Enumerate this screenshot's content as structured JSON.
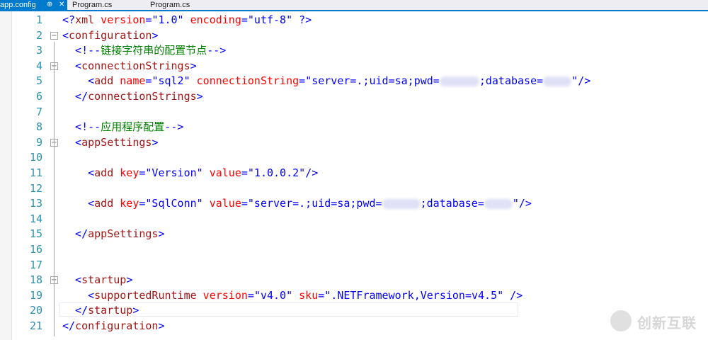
{
  "tabs": [
    {
      "label": "app.config",
      "pin": "⊕",
      "close": "✕",
      "active": true
    },
    {
      "label": "Program.cs",
      "active": false
    },
    {
      "label": "Program.cs",
      "active": false
    }
  ],
  "lines": [
    {
      "n": "1",
      "fold": "",
      "segs": [
        [
          "punct",
          "<?"
        ],
        [
          "ename",
          "xml"
        ],
        [
          "attr",
          " version"
        ],
        [
          "punct",
          "="
        ],
        [
          "val",
          "\"1.0\""
        ],
        [
          "attr",
          " encoding"
        ],
        [
          "punct",
          "="
        ],
        [
          "val",
          "\"utf-8\""
        ],
        [
          "punct",
          " ?>"
        ]
      ]
    },
    {
      "n": "2",
      "fold": "−",
      "segs": [
        [
          "punct",
          "<"
        ],
        [
          "ename",
          "configuration"
        ],
        [
          "punct",
          ">"
        ]
      ]
    },
    {
      "n": "3",
      "fold": "",
      "segs": [
        [
          "punct",
          "  <!--"
        ],
        [
          "cmt",
          "链接字符串的配置节点"
        ],
        [
          "punct",
          "-->"
        ]
      ]
    },
    {
      "n": "4",
      "fold": "−",
      "segs": [
        [
          "punct",
          "  <"
        ],
        [
          "ename",
          "connectionStrings"
        ],
        [
          "punct",
          ">"
        ]
      ]
    },
    {
      "n": "5",
      "fold": "",
      "segs": [
        [
          "punct",
          "    <"
        ],
        [
          "ename",
          "add"
        ],
        [
          "attr",
          " name"
        ],
        [
          "punct",
          "="
        ],
        [
          "val",
          "\"sql2\""
        ],
        [
          "attr",
          " connectionString"
        ],
        [
          "punct",
          "="
        ],
        [
          "val",
          "\"server=.;uid=sa;pwd="
        ],
        [
          "blur",
          "56"
        ],
        [
          "val",
          ";database="
        ],
        [
          "blur",
          "40"
        ],
        [
          "val",
          "\""
        ],
        [
          "punct",
          "/>"
        ]
      ]
    },
    {
      "n": "6",
      "fold": "",
      "segs": [
        [
          "punct",
          "  </"
        ],
        [
          "ename",
          "connectionStrings"
        ],
        [
          "punct",
          ">"
        ]
      ]
    },
    {
      "n": "7",
      "fold": "",
      "segs": []
    },
    {
      "n": "8",
      "fold": "",
      "segs": [
        [
          "punct",
          "  <!--"
        ],
        [
          "cmt",
          "应用程序配置"
        ],
        [
          "punct",
          "-->"
        ]
      ]
    },
    {
      "n": "9",
      "fold": "−",
      "segs": [
        [
          "punct",
          "  <"
        ],
        [
          "ename",
          "appSettings"
        ],
        [
          "punct",
          ">"
        ]
      ]
    },
    {
      "n": "10",
      "fold": "",
      "segs": []
    },
    {
      "n": "11",
      "fold": "",
      "segs": [
        [
          "punct",
          "    <"
        ],
        [
          "ename",
          "add"
        ],
        [
          "attr",
          " key"
        ],
        [
          "punct",
          "="
        ],
        [
          "val",
          "\"Version\""
        ],
        [
          "attr",
          " value"
        ],
        [
          "punct",
          "="
        ],
        [
          "val",
          "\"1.0.0.2\""
        ],
        [
          "punct",
          "/>"
        ]
      ]
    },
    {
      "n": "12",
      "fold": "",
      "segs": []
    },
    {
      "n": "13",
      "fold": "",
      "segs": [
        [
          "punct",
          "    <"
        ],
        [
          "ename",
          "add"
        ],
        [
          "attr",
          " key"
        ],
        [
          "punct",
          "="
        ],
        [
          "val",
          "\"SqlConn\""
        ],
        [
          "attr",
          " value"
        ],
        [
          "punct",
          "="
        ],
        [
          "val",
          "\"server=.;uid=sa;pwd="
        ],
        [
          "blur",
          "54"
        ],
        [
          "val",
          ";database="
        ],
        [
          "blur",
          "40"
        ],
        [
          "val",
          "\""
        ],
        [
          "punct",
          "/>"
        ]
      ]
    },
    {
      "n": "14",
      "fold": "",
      "segs": []
    },
    {
      "n": "15",
      "fold": "",
      "segs": [
        [
          "punct",
          "  </"
        ],
        [
          "ename",
          "appSettings"
        ],
        [
          "punct",
          ">"
        ]
      ]
    },
    {
      "n": "16",
      "fold": "",
      "segs": []
    },
    {
      "n": "17",
      "fold": "",
      "segs": []
    },
    {
      "n": "18",
      "fold": "−",
      "segs": [
        [
          "punct",
          "  <"
        ],
        [
          "ename",
          "startup"
        ],
        [
          "punct",
          ">"
        ]
      ]
    },
    {
      "n": "19",
      "fold": "",
      "segs": [
        [
          "punct",
          "    <"
        ],
        [
          "ename",
          "supportedRuntime"
        ],
        [
          "attr",
          " version"
        ],
        [
          "punct",
          "="
        ],
        [
          "val",
          "\"v4.0\""
        ],
        [
          "attr",
          " sku"
        ],
        [
          "punct",
          "="
        ],
        [
          "val",
          "\".NETFramework,Version=v4.5\""
        ],
        [
          "punct",
          " />"
        ]
      ]
    },
    {
      "n": "20",
      "fold": "",
      "segs": [
        [
          "punct",
          "  </"
        ],
        [
          "ename",
          "startup"
        ],
        [
          "punct",
          ">"
        ]
      ]
    },
    {
      "n": "21",
      "fold": "",
      "segs": [
        [
          "punct",
          "</"
        ],
        [
          "ename",
          "configuration"
        ],
        [
          "punct",
          ">"
        ]
      ]
    }
  ],
  "watermark": {
    "text": "创新互联"
  },
  "colors": {
    "accent": "#007acc",
    "line_number": "#2b91af",
    "element": "#a31515",
    "attribute": "#ff0000",
    "value": "#0000ff",
    "comment": "#008000"
  }
}
